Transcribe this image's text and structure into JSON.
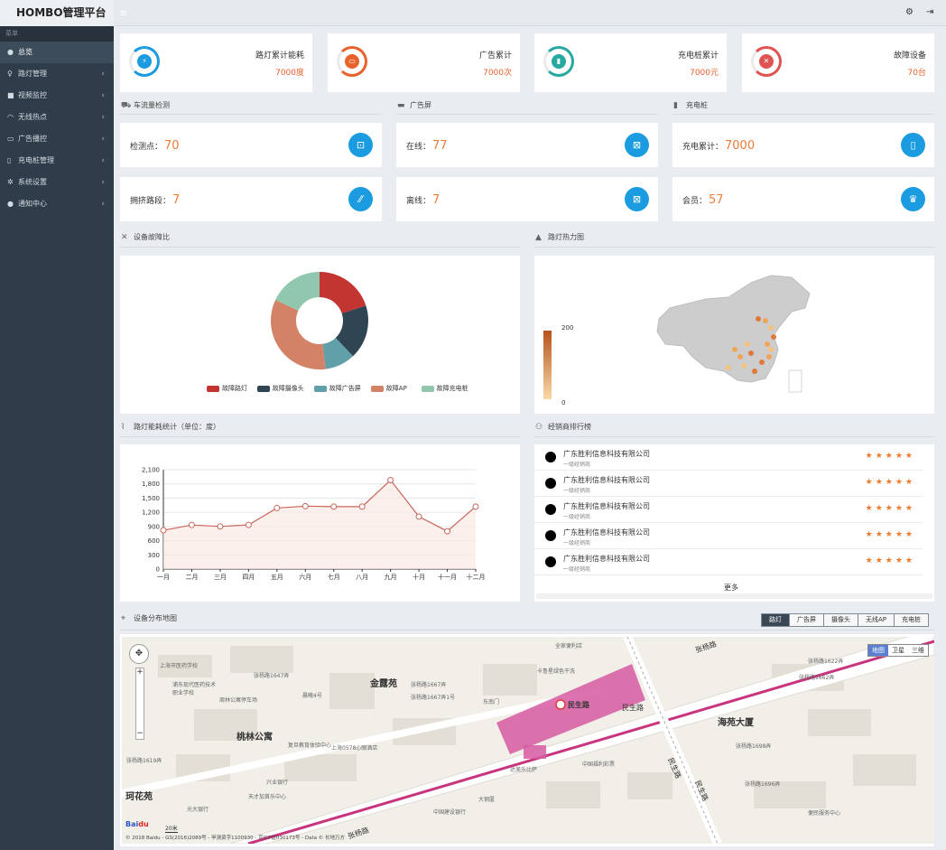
{
  "app": {
    "title": "HOMBO管理平台"
  },
  "sidebar": {
    "header": "菜单",
    "items": [
      {
        "label": "总览",
        "icon": "dashboard-icon"
      },
      {
        "label": "路灯管理",
        "icon": "bulb-icon"
      },
      {
        "label": "视频监控",
        "icon": "camera-icon"
      },
      {
        "label": "无线热点",
        "icon": "wifi-icon"
      },
      {
        "label": "广告播控",
        "icon": "monitor-icon"
      },
      {
        "label": "充电桩管理",
        "icon": "battery-icon"
      },
      {
        "label": "系统设置",
        "icon": "gears-icon"
      },
      {
        "label": "通知中心",
        "icon": "info-icon"
      }
    ]
  },
  "kpis": [
    {
      "label": "路灯累计能耗",
      "value": "7000度",
      "color": "#1b9be0"
    },
    {
      "label": "广告累计",
      "value": "7000次",
      "color": "#e8622c"
    },
    {
      "label": "充电桩累计",
      "value": "7000元",
      "color": "#27a9a0"
    },
    {
      "label": "故障设备",
      "value": "70台",
      "color": "#e05353"
    }
  ],
  "sections": {
    "traffic": "车流量检测",
    "ad": "广告屏",
    "charge": "充电桩",
    "fault": "设备故障比",
    "heat": "路灯热力图",
    "energy": "路灯能耗统计（单位：度）",
    "rank": "经销商排行榜",
    "map": "设备分布地图"
  },
  "stats": {
    "traffic": [
      {
        "label": "检测点：",
        "value": "70"
      },
      {
        "label": "拥挤路段：",
        "value": "7"
      }
    ],
    "ad": [
      {
        "label": "在线：",
        "value": "77"
      },
      {
        "label": "离线：",
        "value": "7"
      }
    ],
    "charge": [
      {
        "label": "充电累计：",
        "value": "7000"
      },
      {
        "label": "会员：",
        "value": "57"
      }
    ]
  },
  "heat": {
    "max": "200",
    "min": "0"
  },
  "chart_data": [
    {
      "type": "pie",
      "title": "",
      "categories": [
        "故障路灯",
        "故障摄像头",
        "故障广告屏",
        "故障AP",
        "故障充电桩"
      ],
      "values": [
        20,
        18,
        10,
        34,
        18
      ],
      "colors": [
        "#c23531",
        "#2f4554",
        "#61a0a8",
        "#d48265",
        "#91c7ae"
      ],
      "legend": "bottom"
    },
    {
      "type": "line",
      "title": "",
      "categories": [
        "一月",
        "二月",
        "三月",
        "四月",
        "五月",
        "六月",
        "七月",
        "八月",
        "九月",
        "十月",
        "十一月",
        "十二月"
      ],
      "values": [
        820,
        932,
        901,
        934,
        1290,
        1330,
        1320,
        1320,
        1880,
        1110,
        800,
        1320
      ],
      "yticks": [
        "0",
        "300",
        "600",
        "900",
        "1,200",
        "1,500",
        "1,800",
        "2,100"
      ],
      "ylim": [
        0,
        2100
      ],
      "grid": true,
      "color": "#c9675c"
    }
  ],
  "rank": {
    "items": [
      {
        "name": "广东胜利信息科技有限公司",
        "sub": "一级经销商",
        "stars": "★★★★★"
      },
      {
        "name": "广东胜利信息科技有限公司",
        "sub": "一级经销商",
        "stars": "★★★★★"
      },
      {
        "name": "广东胜利信息科技有限公司",
        "sub": "一级经销商",
        "stars": "★★★★★"
      },
      {
        "name": "广东胜利信息科技有限公司",
        "sub": "一级经销商",
        "stars": "★★★★★"
      },
      {
        "name": "广东胜利信息科技有限公司",
        "sub": "一级经销商",
        "stars": "★★★★★"
      }
    ],
    "more": "更多"
  },
  "map": {
    "tabs": [
      "路灯",
      "广告屏",
      "摄像头",
      "无线AP",
      "充电桩"
    ],
    "types": [
      "地图",
      "卫星",
      "三维"
    ],
    "big_labels": [
      "金露苑",
      "桃林公寓",
      "海苑大厦",
      "珂花苑",
      "民生路",
      "民生路",
      "张杨路",
      "张杨路",
      "民生路",
      "民生路"
    ],
    "small_labels": [
      "上海市医药学校",
      "张杨路1647弄",
      "张杨路1667弄",
      "浦东现代医药技术职业学校",
      "周林公寓停车场",
      "晨曦4号",
      "上海0578心眼酒店",
      "张杨路1667弄1号",
      "张杨路1619弄",
      "复旦教育体验中心",
      "兴业银行",
      "天才加首乐中心",
      "光大银行",
      "中国建设银行",
      "大钢厦",
      "达美乐比萨",
      "中国福利彩票",
      "张杨路1662弄",
      "张杨路1622弄",
      "便民服务中心",
      "全家便利店",
      "卡鲁星绿色干洗",
      "东南门",
      "张杨路1698弄",
      "张杨路1696弄"
    ],
    "copyright": "© 2018 Baidu - GS(2016)2089号 - 甲测资字1100930 - 京ICP证030173号 - Data © 长地万方",
    "scale": "20米"
  }
}
